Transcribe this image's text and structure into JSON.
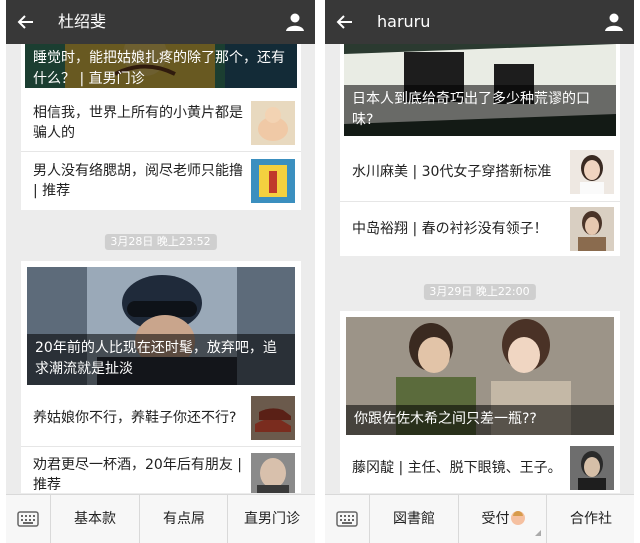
{
  "left": {
    "title": "杜绍斐",
    "top_caption": "睡觉时，能把姑娘扎疼的除了那个，还有什么？ | 直男门诊",
    "rows_top": [
      {
        "text": "相信我，世界上所有的小黄片都是骗人的",
        "thumb": "chick-icon"
      },
      {
        "text": "男人没有络腮胡，阅尽老师只能撸 | 推荐",
        "thumb": "cartoon-hand-icon"
      }
    ],
    "timestamp": "3月28日 晚上23:52",
    "feature_caption": "20年前的人比现在还时髦，放弃吧，追求潮流就是扯淡",
    "rows_bottom": [
      {
        "text": "养姑娘你不行，养鞋子你还不行?",
        "thumb": "shoes-icon"
      },
      {
        "text": "劝君更尽一杯酒，20年后有朋友 | 推荐",
        "thumb": "man-portrait-icon"
      }
    ],
    "menu": [
      "基本款",
      "有点屌",
      "直男门诊"
    ]
  },
  "right": {
    "title": "haruru",
    "top_caption": "日本人到底给奇巧出了多少种荒谬的口味?",
    "rows_top": [
      {
        "text": "水川麻美 | 30代女子穿搭新标准",
        "thumb": "woman-portrait-icon"
      },
      {
        "text": "中岛裕翔 | 春の衬衫没有领子！",
        "thumb": "young-man-icon"
      }
    ],
    "timestamp": "3月29日 晚上22:00",
    "feature_caption": "你跟佐佐木希之间只差一瓶??",
    "rows_bottom": [
      {
        "text": "藤冈靛 | 主任、脱下眼镜、王子。",
        "thumb": "man-glasses-icon"
      }
    ],
    "menu": [
      "図書館",
      "受付",
      "合作社"
    ]
  },
  "colors": {
    "topbar": "#383838",
    "background": "#ececec",
    "pill": "#cfcfcf"
  }
}
